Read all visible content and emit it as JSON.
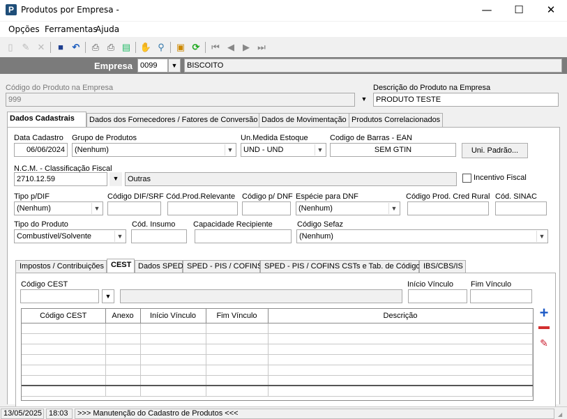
{
  "window": {
    "title": "Produtos por Empresa -",
    "app_icon": "P",
    "minimize": "—",
    "maximize": "☐",
    "close": "✕"
  },
  "menu": [
    "Opções",
    "Ferramentas",
    "Ajuda"
  ],
  "empresa": {
    "label": "Empresa",
    "code": "0099",
    "name": "BISCOITO"
  },
  "codigo_produto": {
    "label": "Código do Produto na Empresa",
    "value": "999"
  },
  "descricao_produto": {
    "label": "Descrição do Produto na Empresa",
    "value": "PRODUTO TESTE"
  },
  "main_tabs": [
    "Dados Cadastrais",
    "Dados dos Fornecedores / Fatores de Conversão",
    "Dados de Movimentação",
    "Produtos Correlacionados"
  ],
  "form": {
    "data_cadastro": {
      "label": "Data Cadastro",
      "value": "06/06/2024"
    },
    "grupo_produtos": {
      "label": "Grupo de Produtos",
      "value": "(Nenhum)"
    },
    "un_medida": {
      "label": "Un.Medida Estoque",
      "value": "UND - UND"
    },
    "codigo_barras": {
      "label": "Codigo de Barras - EAN",
      "value": "SEM GTIN"
    },
    "uni_padrao_button": "Uni. Padrão...",
    "ncm": {
      "label": "N.C.M. -  Classificação Fiscal",
      "value": "2710.12.59",
      "description": "Outras"
    },
    "incentivo_fiscal": {
      "label": "Incentivo Fiscal",
      "checked": false
    },
    "tipo_dif": {
      "label": "Tipo p/DIF",
      "value": "(Nenhum)"
    },
    "codigo_dif_srf": {
      "label": "Código DIF/SRF",
      "value": ""
    },
    "cod_prod_relevante": {
      "label": "Cód.Prod.Relevante",
      "value": ""
    },
    "codigo_dnf": {
      "label": "Código p/ DNF",
      "value": ""
    },
    "especie_dnf": {
      "label": "Espécie para DNF",
      "value": "(Nenhum)"
    },
    "cod_prod_cred_rural": {
      "label": "Código Prod. Cred Rural",
      "value": ""
    },
    "cod_sinac": {
      "label": "Cód. SINAC",
      "value": ""
    },
    "tipo_produto": {
      "label": "Tipo do Produto",
      "value": "Combustível/Solvente"
    },
    "cod_insumo": {
      "label": "Cód. Insumo",
      "value": ""
    },
    "capacidade_recipiente": {
      "label": "Capacidade Recipiente",
      "value": ""
    },
    "codigo_sefaz": {
      "label": "Código Sefaz",
      "value": "(Nenhum)"
    }
  },
  "sub_tabs": [
    "Impostos / Contribuições",
    "CEST",
    "Dados SPED",
    "SPED - PIS / COFINS",
    "SPED - PIS / COFINS CSTs e Tab. de Códigos",
    "IBS/CBS/IS"
  ],
  "cest": {
    "codigo_label": "Código CEST",
    "inicio_label": "Início Vínculo",
    "fim_label": "Fim Vínculo",
    "grid_headers": [
      "Código CEST",
      "Anexo",
      "Início Vínculo",
      "Fim Vínculo",
      "Descrição"
    ]
  },
  "status": {
    "date": "13/05/2025",
    "time": "18:03",
    "message": ">>> Manutenção do Cadastro de Produtos <<<"
  },
  "colors": {
    "empresa_bar": "#7b7b7b",
    "add": "#1e5bc6",
    "remove": "#d32f2f"
  }
}
